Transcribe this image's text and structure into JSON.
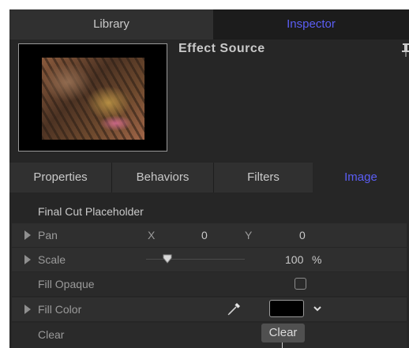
{
  "top_tabs": {
    "library": "Library",
    "inspector": "Inspector"
  },
  "header": {
    "title": "Effect Source"
  },
  "sub_tabs": {
    "properties": "Properties",
    "behaviors": "Behaviors",
    "filters": "Filters",
    "image": "Image"
  },
  "section": {
    "label": "Final Cut Placeholder"
  },
  "rows": {
    "pan": {
      "label": "Pan",
      "x_label": "X",
      "x_value": "0",
      "y_label": "Y",
      "y_value": "0"
    },
    "scale": {
      "label": "Scale",
      "value": "100",
      "unit": "%",
      "slider_fraction": 0.2
    },
    "fill_opaque": {
      "label": "Fill Opaque",
      "checked": false
    },
    "fill_color": {
      "label": "Fill Color",
      "color": "#000000"
    },
    "clear": {
      "label": "Clear",
      "button_label": "Clear"
    }
  },
  "colors": {
    "accent": "#5b5ef5"
  },
  "icons": {
    "pin": "pin-icon",
    "dropper": "eyedropper-icon",
    "chevron": "chevron-down-icon",
    "disclosure": "disclosure-triangle-icon"
  }
}
